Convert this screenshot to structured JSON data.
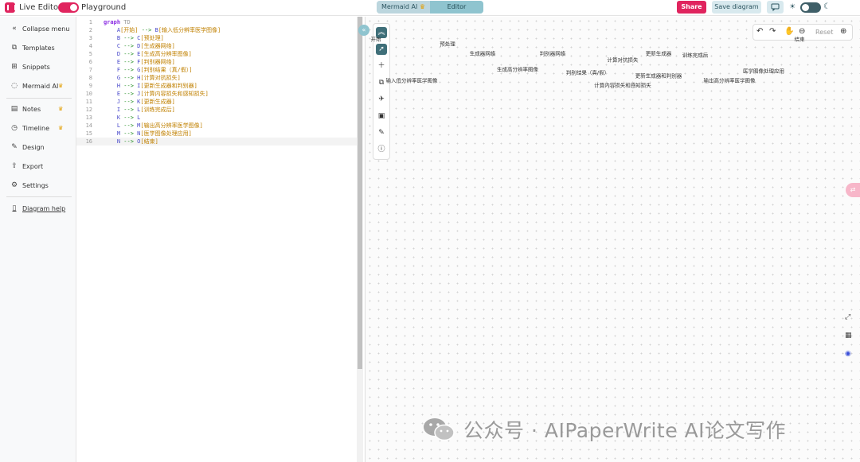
{
  "header": {
    "app_title": "Live Editor",
    "mode_label": "Playground",
    "tabs": [
      {
        "label": "Mermaid AI"
      },
      {
        "label": "Editor"
      }
    ],
    "share_label": "Share",
    "save_label": "Save diagram"
  },
  "sidebar": {
    "items": [
      {
        "label": "Collapse menu",
        "icon": "collapse-icon"
      },
      {
        "label": "Templates",
        "icon": "templates-icon"
      },
      {
        "label": "Snippets",
        "icon": "snippets-icon"
      },
      {
        "label": "Mermaid AI",
        "icon": "ai-chat-icon",
        "premium": true
      },
      {
        "label": "Notes",
        "icon": "notes-icon",
        "premium": true
      },
      {
        "label": "Timeline",
        "icon": "timeline-icon",
        "premium": true
      },
      {
        "label": "Design",
        "icon": "design-icon"
      },
      {
        "label": "Export",
        "icon": "export-icon"
      },
      {
        "label": "Settings",
        "icon": "settings-icon"
      },
      {
        "label": "Diagram help",
        "icon": "book-icon"
      }
    ]
  },
  "editor": {
    "lines": [
      {
        "n": "1",
        "text": "graph TD"
      },
      {
        "n": "2",
        "text": "    A[开始] --> B[输入低分辨率医学图像]"
      },
      {
        "n": "3",
        "text": "    B --> C[预处理]"
      },
      {
        "n": "4",
        "text": "    C --> D[生成器网络]"
      },
      {
        "n": "5",
        "text": "    D --> E[生成高分辨率图像]"
      },
      {
        "n": "6",
        "text": "    E --> F[判别器网络]"
      },
      {
        "n": "7",
        "text": "    F --> G[判别结果（真/假）]"
      },
      {
        "n": "8",
        "text": "    G --> H[计算对抗损失]"
      },
      {
        "n": "9",
        "text": "    H --> I[更新生成器和判别器]"
      },
      {
        "n": "10",
        "text": "    E --> J[计算内容损失和感知损失]"
      },
      {
        "n": "11",
        "text": "    J --> K[更新生成器]"
      },
      {
        "n": "12",
        "text": "    I --> L[训练完成后]"
      },
      {
        "n": "13",
        "text": "    K --> L"
      },
      {
        "n": "14",
        "text": "    L --> M[输出高分辨率医学图像]"
      },
      {
        "n": "15",
        "text": "    M --> N[医学图像处理应用]"
      },
      {
        "n": "16",
        "text": "    N --> O[结束]"
      }
    ]
  },
  "zoombar": {
    "reset_label": "Reset"
  },
  "diagram": {
    "nodes": {
      "A": "开始",
      "B": "输入低分辨率医学图像",
      "C": "预处理",
      "D": "生成器网络",
      "E": "生成高分辨率图像",
      "F": "判别器网络",
      "G": "判别结果（真/假）",
      "H": "计算对抗损失",
      "I": "更新生成器和判别器",
      "J": "计算内容损失和感知损失",
      "K": "更新生成器",
      "L": "训练完成后",
      "M": "输出高分辨率医学图像",
      "N": "医学图像处理应用",
      "O": "结束"
    }
  },
  "watermark": {
    "text": "公众号 · AIPaperWrite AI论文写作"
  },
  "colors": {
    "brand": "#e0245e",
    "accent": "#3f6f79",
    "tab_bg": "#c2dde4"
  }
}
